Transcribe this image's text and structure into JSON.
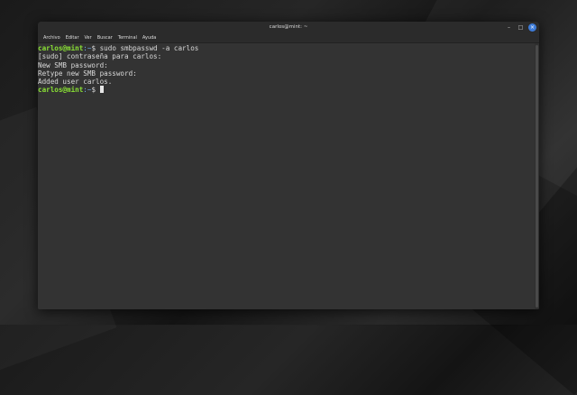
{
  "window": {
    "title": "carlos@mint: ~",
    "controls": {
      "minimize": "–",
      "maximize": "□",
      "close": "×"
    }
  },
  "menu": [
    "Archivo",
    "Editar",
    "Ver",
    "Buscar",
    "Terminal",
    "Ayuda"
  ],
  "terminal": {
    "prompt": {
      "user_host": "carlos@mint",
      "path": ":~",
      "symbol": "$ "
    },
    "lines": [
      {
        "type": "prompt",
        "command": "sudo smbpasswd -a carlos"
      },
      {
        "type": "output",
        "text": "[sudo] contraseña para carlos:"
      },
      {
        "type": "output",
        "text": "New SMB password:"
      },
      {
        "type": "output",
        "text": "Retype new SMB password:"
      },
      {
        "type": "output",
        "text": "Added user carlos."
      },
      {
        "type": "prompt",
        "command": ""
      }
    ]
  },
  "colors": {
    "prompt_user": "#8ae234",
    "prompt_path": "#6fa7e6",
    "close_button": "#3d7bd8",
    "terminal_bg": "#333333"
  }
}
